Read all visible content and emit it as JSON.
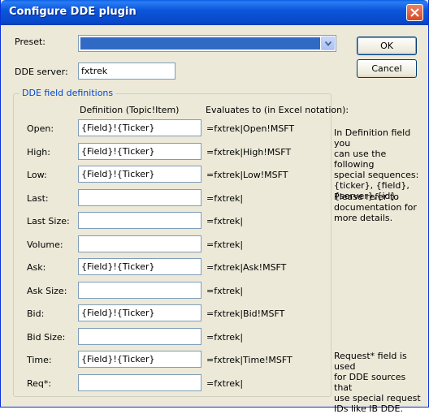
{
  "window": {
    "title": "Configure DDE plugin"
  },
  "preset": {
    "label": "Preset:",
    "value": ""
  },
  "dde_server": {
    "label": "DDE server:",
    "value": "fxtrek"
  },
  "buttons": {
    "ok": "OK",
    "cancel": "Cancel"
  },
  "group": {
    "title": "DDE field definitions",
    "col_definition": "Definition (Topic!Item)",
    "col_evaluates": "Evaluates to (in Excel notation):",
    "rows": [
      {
        "label": "Open:",
        "definition": "{Field}!{Ticker}",
        "evaluates": "=fxtrek|Open!MSFT"
      },
      {
        "label": "High:",
        "definition": "{Field}!{Ticker}",
        "evaluates": "=fxtrek|High!MSFT"
      },
      {
        "label": "Low:",
        "definition": "{Field}!{Ticker}",
        "evaluates": "=fxtrek|Low!MSFT"
      },
      {
        "label": "Last:",
        "definition": "",
        "evaluates": "=fxtrek|"
      },
      {
        "label": "Last Size:",
        "definition": "",
        "evaluates": "=fxtrek|"
      },
      {
        "label": "Volume:",
        "definition": "",
        "evaluates": "=fxtrek|"
      },
      {
        "label": "Ask:",
        "definition": "{Field}!{Ticker}",
        "evaluates": "=fxtrek|Ask!MSFT"
      },
      {
        "label": "Ask Size:",
        "definition": "",
        "evaluates": "=fxtrek|"
      },
      {
        "label": "Bid:",
        "definition": "{Field}!{Ticker}",
        "evaluates": "=fxtrek|Bid!MSFT"
      },
      {
        "label": "Bid Size:",
        "definition": "",
        "evaluates": "=fxtrek|"
      },
      {
        "label": "Time:",
        "definition": "{Field}!{Ticker}",
        "evaluates": "=fxtrek|Time!MSFT"
      },
      {
        "label": "Req*:",
        "definition": "",
        "evaluates": "=fxtrek|"
      }
    ]
  },
  "notes": {
    "special_sequences": [
      "In Definition field you",
      "can use the following",
      "special sequences:",
      "{ticker}, {field},",
      "{server},{id}."
    ],
    "refer_docs": [
      "Please refer to",
      "documentation for",
      "more details."
    ],
    "request_field": [
      "Request* field is used",
      "for DDE sources that",
      "use special request",
      "IDs like IB DDE."
    ]
  },
  "colors": {
    "titlebar": "#0c56db",
    "dialog_bg": "#ece9d8",
    "group_title": "#0046d5",
    "selection": "#316ac5"
  }
}
